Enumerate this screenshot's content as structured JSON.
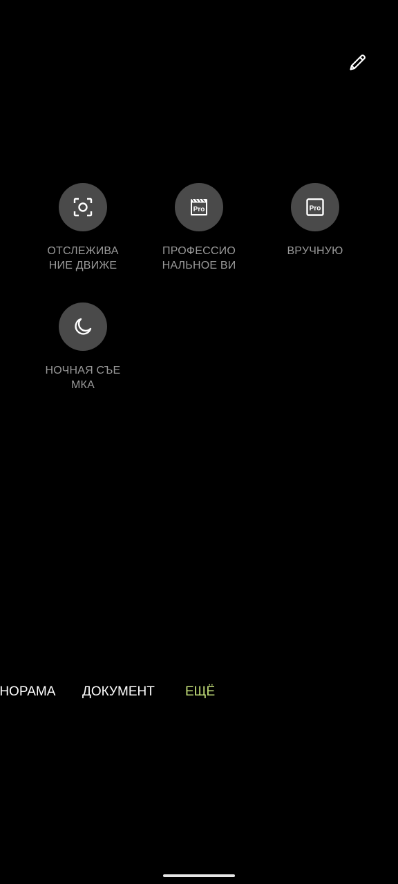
{
  "toolbar": {
    "edit_icon": "pencil-icon"
  },
  "modes": [
    {
      "label": "ОТСЛЕЖИВАНИЕ ДВИЖЕНИЯ",
      "icon": "focus-frame-icon"
    },
    {
      "label": "ПРОФЕССИОНАЛЬНОЕ ВИДЕО",
      "icon": "pro-video-icon"
    },
    {
      "label": "ВРУЧНУЮ",
      "icon": "pro-icon"
    },
    {
      "label": "НОЧНАЯ СЪЕМКА",
      "icon": "moon-icon"
    }
  ],
  "mode_strip": {
    "items": [
      "ПАНОРАМА",
      "ДОКУМЕНТ",
      "ЕЩЁ"
    ],
    "partial_first_visible": "ОРАМА",
    "active_index": 2
  },
  "colors": {
    "background": "#000000",
    "circle": "#4a4a4a",
    "label": "#9a9a9a",
    "active": "#c4e07a",
    "strip_text": "#ffffff"
  },
  "icon_badge_text": "Pro"
}
